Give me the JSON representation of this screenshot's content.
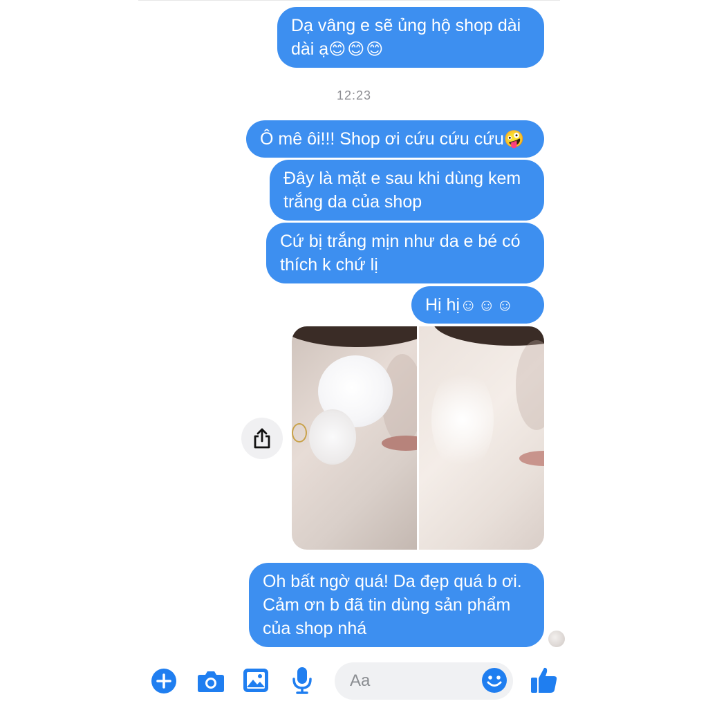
{
  "conversation": {
    "messages": [
      {
        "lines": [
          "Dạ vâng e sẽ ủng hộ shop dài",
          "dài ạ"
        ],
        "emoji": "😊😊😊"
      },
      {
        "timestamp": "12:23"
      },
      {
        "lines": [
          "Ô mê ôi!!! Shop ơi cứu cứu cứu"
        ],
        "emoji": "🤪"
      },
      {
        "lines": [
          "Đây là mặt e sau khi dùng kem",
          "trắng da của shop"
        ]
      },
      {
        "lines": [
          "Cứ bị trắng mịn như da e bé có",
          "thích k chứ lị"
        ]
      },
      {
        "lines": [
          "Hị hị"
        ],
        "emoji": "☺☺☺"
      },
      {
        "image": "before-after-face-photo"
      },
      {
        "lines": [
          "Oh bất ngờ quá! Da đẹp quá b ơi.",
          "Cảm ơn b đã tin dùng sản phẩm",
          "của shop nhá"
        ]
      }
    ]
  },
  "composer": {
    "placeholder": "Aa",
    "icons": [
      "plus-icon",
      "camera-icon",
      "gallery-icon",
      "microphone-icon",
      "emoji-icon",
      "thumbs-up-icon"
    ]
  },
  "colors": {
    "bubble": "#3d8ff0",
    "accent": "#1f7ef0",
    "timestamp": "#8e8e93"
  }
}
